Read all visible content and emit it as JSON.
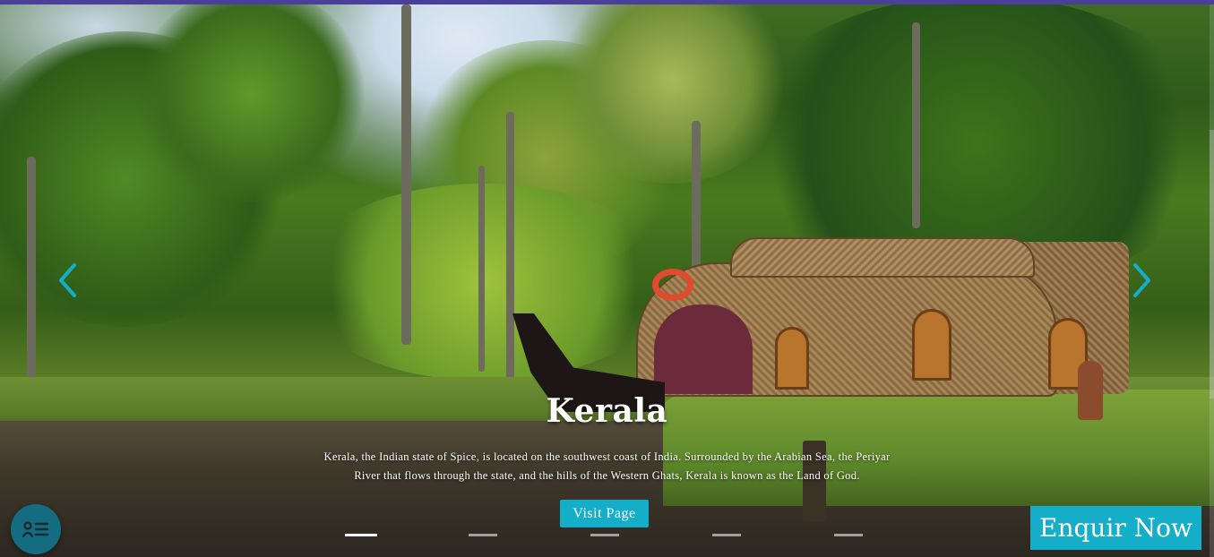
{
  "slide": {
    "title": "Kerala",
    "description": "Kerala, the Indian state of Spice, is located on the southwest coast of India. Surrounded by the Arabian Sea, the Periyar River that flows through the state, and the hills of the Western Ghats, Kerala is known as the Land of God.",
    "visit_label": "Visit Page",
    "image_alt": "houseboat-backwaters-image"
  },
  "carousel": {
    "prev_icon": "chevron-left-icon",
    "next_icon": "chevron-right-icon",
    "indicator_count": 5,
    "active_index": 0,
    "accent": "#14aec8"
  },
  "enquire": {
    "label": "Enquir Now"
  },
  "menu_fab": {
    "icon": "menu-list-icon"
  },
  "colors": {
    "topbar": "#4a3f9a",
    "accent": "#14aec8",
    "fab": "#136c80"
  }
}
